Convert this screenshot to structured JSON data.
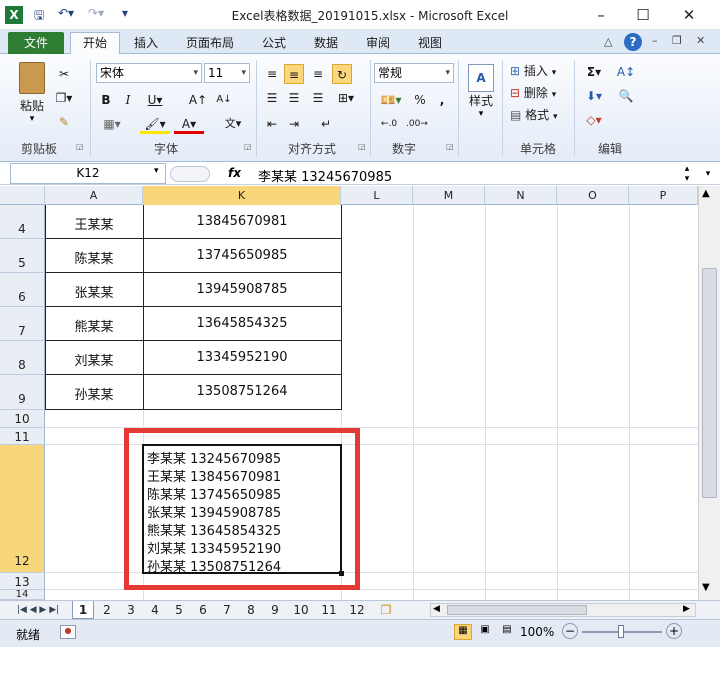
{
  "window": {
    "title": "Excel表格数据_20191015.xlsx - Microsoft Excel"
  },
  "ribbon_tabs": [
    "文件",
    "开始",
    "插入",
    "页面布局",
    "公式",
    "数据",
    "审阅",
    "视图"
  ],
  "ribbon": {
    "clipboard": {
      "paste": "粘贴",
      "label": "剪贴板"
    },
    "font": {
      "name": "宋体",
      "size": "11",
      "label": "字体"
    },
    "alignment": {
      "label": "对齐方式"
    },
    "number": {
      "format": "常规",
      "percent": "%",
      "comma": ",",
      "label": "数字"
    },
    "styles": {
      "label": "样式"
    },
    "cells": {
      "insert": "插入",
      "delete": "删除",
      "format": "格式",
      "label": "单元格"
    },
    "editing": {
      "label": "编辑"
    }
  },
  "formula_bar": {
    "name_box": "K12",
    "fx": "fx",
    "value": "李某某 13245670985"
  },
  "grid": {
    "columns": [
      "A",
      "K",
      "L",
      "M",
      "N",
      "O",
      "P"
    ],
    "rows": [
      {
        "num": "4",
        "name": "王某某",
        "phone": "13845670981"
      },
      {
        "num": "5",
        "name": "陈某某",
        "phone": "13745650985"
      },
      {
        "num": "6",
        "name": "张某某",
        "phone": "13945908785"
      },
      {
        "num": "7",
        "name": "熊某某",
        "phone": "13645854325"
      },
      {
        "num": "8",
        "name": "刘某某",
        "phone": "13345952190"
      },
      {
        "num": "9",
        "name": "孙某某",
        "phone": "13508751264"
      }
    ],
    "extra_rows": [
      "10",
      "11",
      "12",
      "13",
      "14"
    ],
    "k12_lines": [
      "李某某 13245670985",
      "王某某 13845670981",
      "陈某某 13745650985",
      "张某某 13945908785",
      "熊某某 13645854325",
      "刘某某 13345952190",
      "孙某某 13508751264"
    ]
  },
  "sheet_tabs": [
    "1",
    "2",
    "3",
    "4",
    "5",
    "6",
    "7",
    "8",
    "9",
    "10",
    "11",
    "12"
  ],
  "status": {
    "ready": "就绪",
    "zoom": "100%"
  },
  "colors": {
    "highlight_box": "#e53935",
    "selected_header": "#f7d77a",
    "file_tab": "#2f7d32"
  }
}
